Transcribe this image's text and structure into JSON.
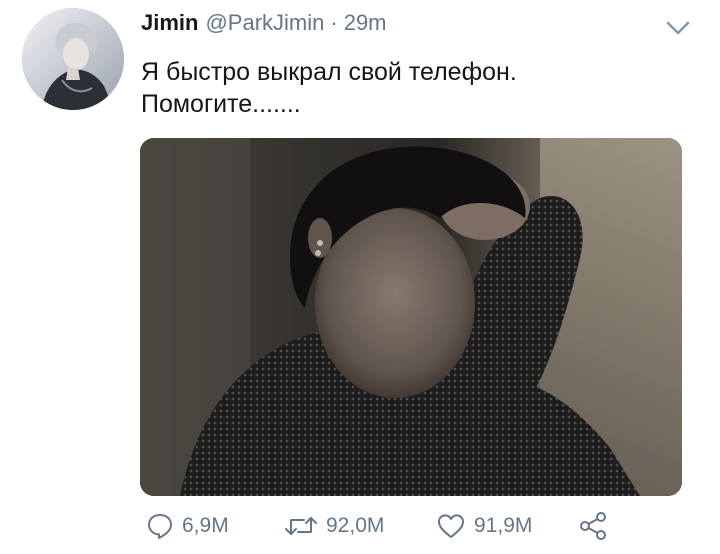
{
  "tweet": {
    "display_name": "Jimin",
    "handle": "@ParkJimin",
    "separator": "·",
    "time": "29m",
    "text_lines": [
      "Я быстро выкрал свой телефон.",
      "Помогите......."
    ],
    "avatar_icon": "profile-avatar",
    "menu_icon": "chevron-down-icon",
    "media_description_icon": "attached-photo"
  },
  "actions": {
    "reply_count": "6,9M",
    "retweet_count": "92,0M",
    "like_count": "91,9M",
    "reply_icon": "reply-bubble-icon",
    "retweet_icon": "retweet-icon",
    "like_icon": "heart-icon",
    "share_icon": "share-icon"
  },
  "colors": {
    "text_primary": "#14171a",
    "text_secondary": "#657786",
    "icon_gray": "#657786",
    "background": "#ffffff"
  }
}
